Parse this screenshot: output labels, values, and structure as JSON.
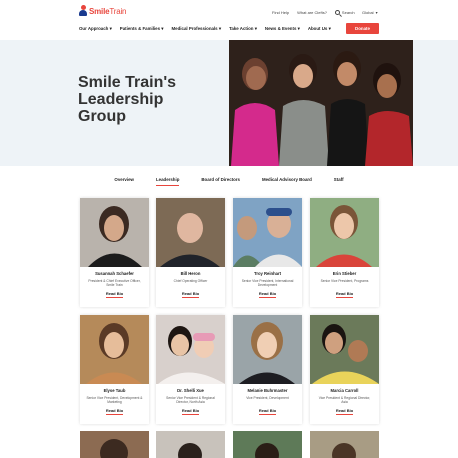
{
  "header": {
    "logo_text_bold": "Smile",
    "logo_text_light": "Train",
    "utility_links": [
      "Find Help",
      "What are Clefts?"
    ],
    "search_label": "Search",
    "global_label": "Global",
    "nav_items": [
      "Our Approach",
      "Patients & Families",
      "Medical Professionals",
      "Take Action",
      "News & Events",
      "About Us"
    ],
    "donate_label": "Donate",
    "brand_color": "#e8453c"
  },
  "hero": {
    "title": "Smile Train's Leadership Group"
  },
  "tabs": [
    {
      "label": "Overview",
      "active": false
    },
    {
      "label": "Leadership",
      "active": true
    },
    {
      "label": "Board of Directors",
      "active": false
    },
    {
      "label": "Medical Advisory Board",
      "active": false
    },
    {
      "label": "Staff",
      "active": false
    }
  ],
  "read_bio_label": "Read Bio",
  "leaders": [
    {
      "name": "Susannah Schaefer",
      "role": "President & Chief Executive Officer, Smile Train"
    },
    {
      "name": "Bill Heron",
      "role": "Chief Operating Officer"
    },
    {
      "name": "Troy Reinhart",
      "role": "Senior Vice President, International Development"
    },
    {
      "name": "Erin Stieber",
      "role": "Senior Vice President, Programs"
    },
    {
      "name": "Elyse Taub",
      "role": "Senior Vice President, Development & Marketing"
    },
    {
      "name": "Dr. Shelli Xue",
      "role": "Senior Vice President & Regional Director, North Asia"
    },
    {
      "name": "Melanie Buhrmaster",
      "role": "Vice President, Development"
    },
    {
      "name": "Marcia Carroll",
      "role": "Vice President & Regional Director, Asia"
    }
  ]
}
